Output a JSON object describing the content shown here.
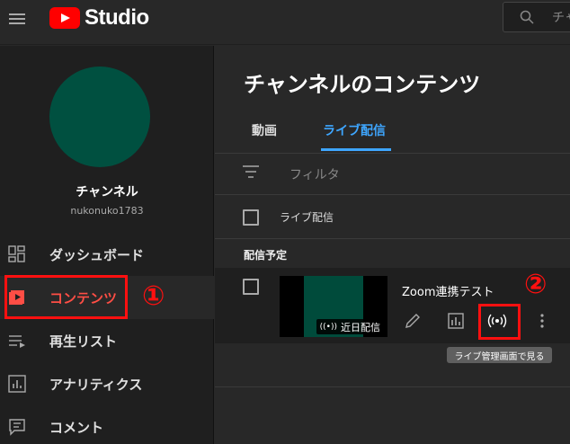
{
  "header": {
    "logo_text": "Studio",
    "search_placeholder": "チャ"
  },
  "sidebar": {
    "channel_name": "チャンネル",
    "channel_handle": "nukonuko1783",
    "items": [
      {
        "label": "ダッシュボード",
        "icon": "dashboard-icon"
      },
      {
        "label": "コンテンツ",
        "icon": "content-icon",
        "active": true
      },
      {
        "label": "再生リスト",
        "icon": "playlist-icon"
      },
      {
        "label": "アナリティクス",
        "icon": "analytics-icon"
      },
      {
        "label": "コメント",
        "icon": "comments-icon"
      }
    ]
  },
  "annotations": {
    "one": "①",
    "two": "②"
  },
  "main": {
    "title": "チャンネルのコンテンツ",
    "tabs": [
      {
        "label": "動画",
        "active": false
      },
      {
        "label": "ライブ配信",
        "active": true
      }
    ],
    "filter_label": "フィルタ",
    "column_header": "ライブ配信",
    "section_label": "配信予定",
    "rows": [
      {
        "title": "Zoom連携テスト",
        "badge": "近日配信",
        "tooltip": "ライブ管理画面で見る"
      }
    ]
  },
  "colors": {
    "accent_red": "#ff4e45",
    "link_blue": "#3ea6ff",
    "annotation_red": "#ff1010",
    "avatar": "#005040"
  }
}
